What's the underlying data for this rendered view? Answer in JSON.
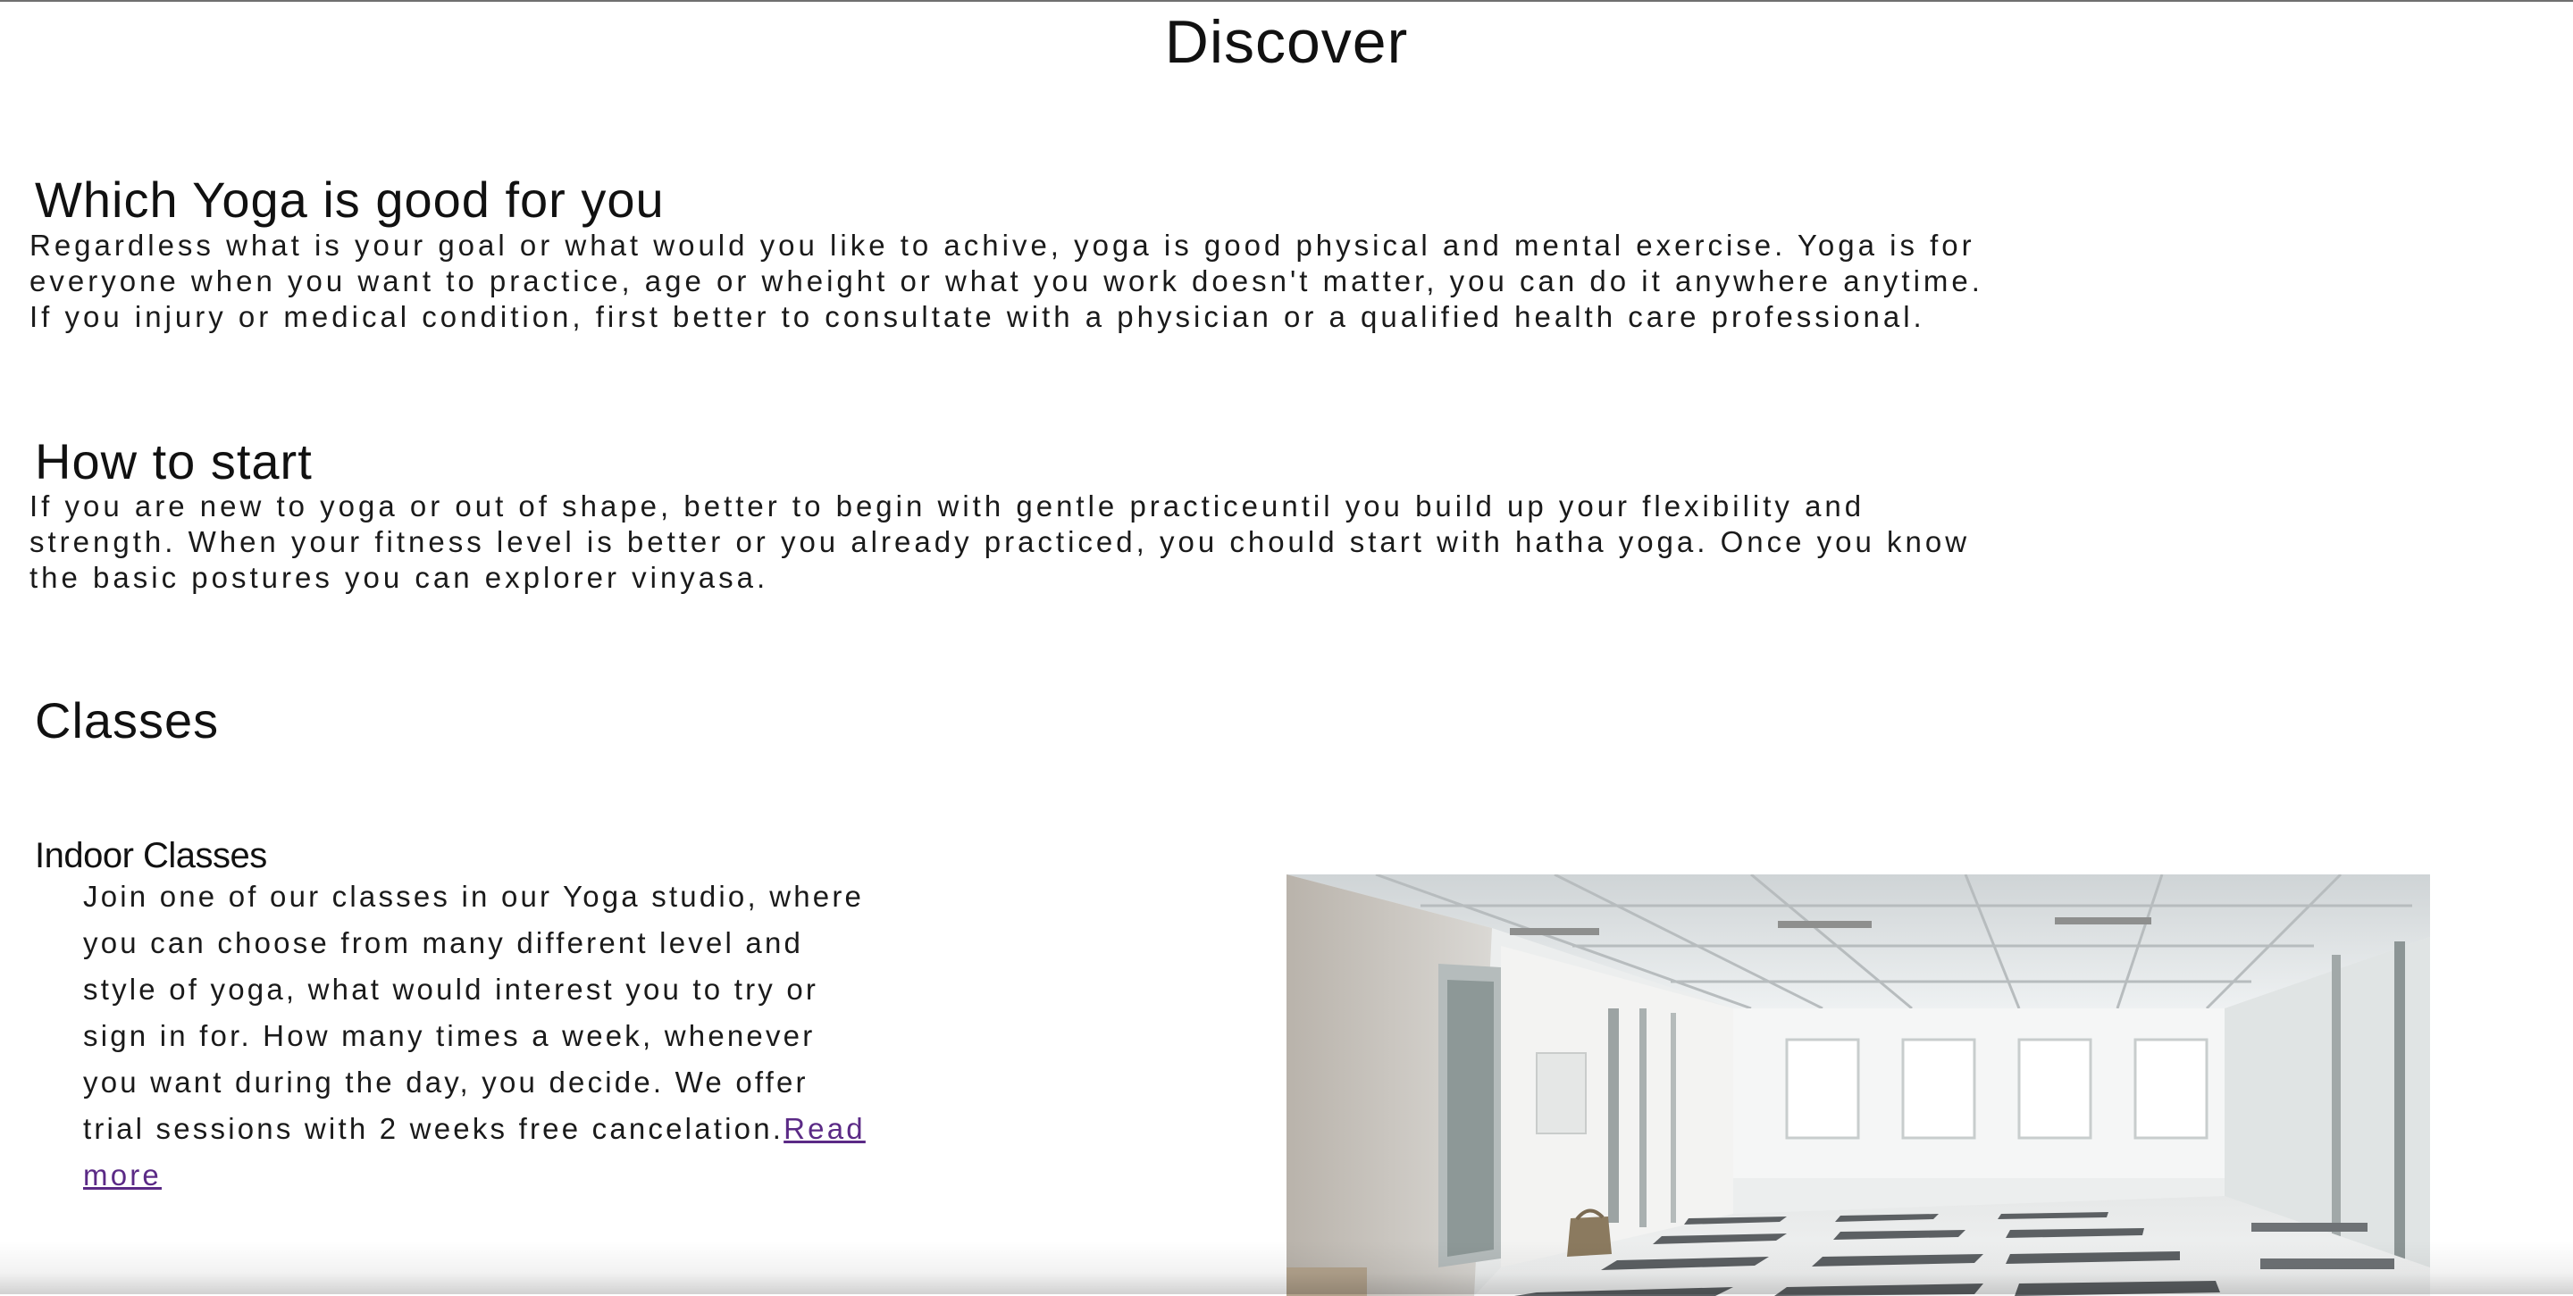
{
  "page": {
    "title": "Discover"
  },
  "sections": [
    {
      "heading": "Which Yoga is good for you",
      "lines": [
        "Regardless what is your goal or what would you like to achive, yoga is good physical and mental exercise. Yoga is for",
        "everyone when you want to practice, age or wheight or what you work doesn't matter, you can do it anywhere anytime.",
        "If you injury or medical condition, first better to consultate with a physician or a qualified health care professional."
      ]
    },
    {
      "heading": "How to start",
      "lines": [
        "If you are new to yoga or out of shape, better to begin with gentle practiceuntil you build up your flexibility and",
        "strength. When your fitness level is better or you already practiced, you chould start with hatha yoga. Once you know",
        "the basic postures you can explorer vinyasa."
      ]
    },
    {
      "heading": "Classes"
    }
  ],
  "classes": {
    "indoor": {
      "title": "Indoor Classes",
      "lines": [
        "Join one of our classes in our Yoga studio, where",
        "you can choose from many different level and",
        "style of yoga, what would interest you to try or",
        "sign in for. How many times a week, whenever",
        "you want during the day, you decide. We offer",
        "trial sessions with 2 weeks free cancelation."
      ],
      "link_label_1": "Read",
      "link_label_2": "more"
    }
  },
  "colors": {
    "link": "#5b2a86",
    "text": "#1a1a1a"
  }
}
